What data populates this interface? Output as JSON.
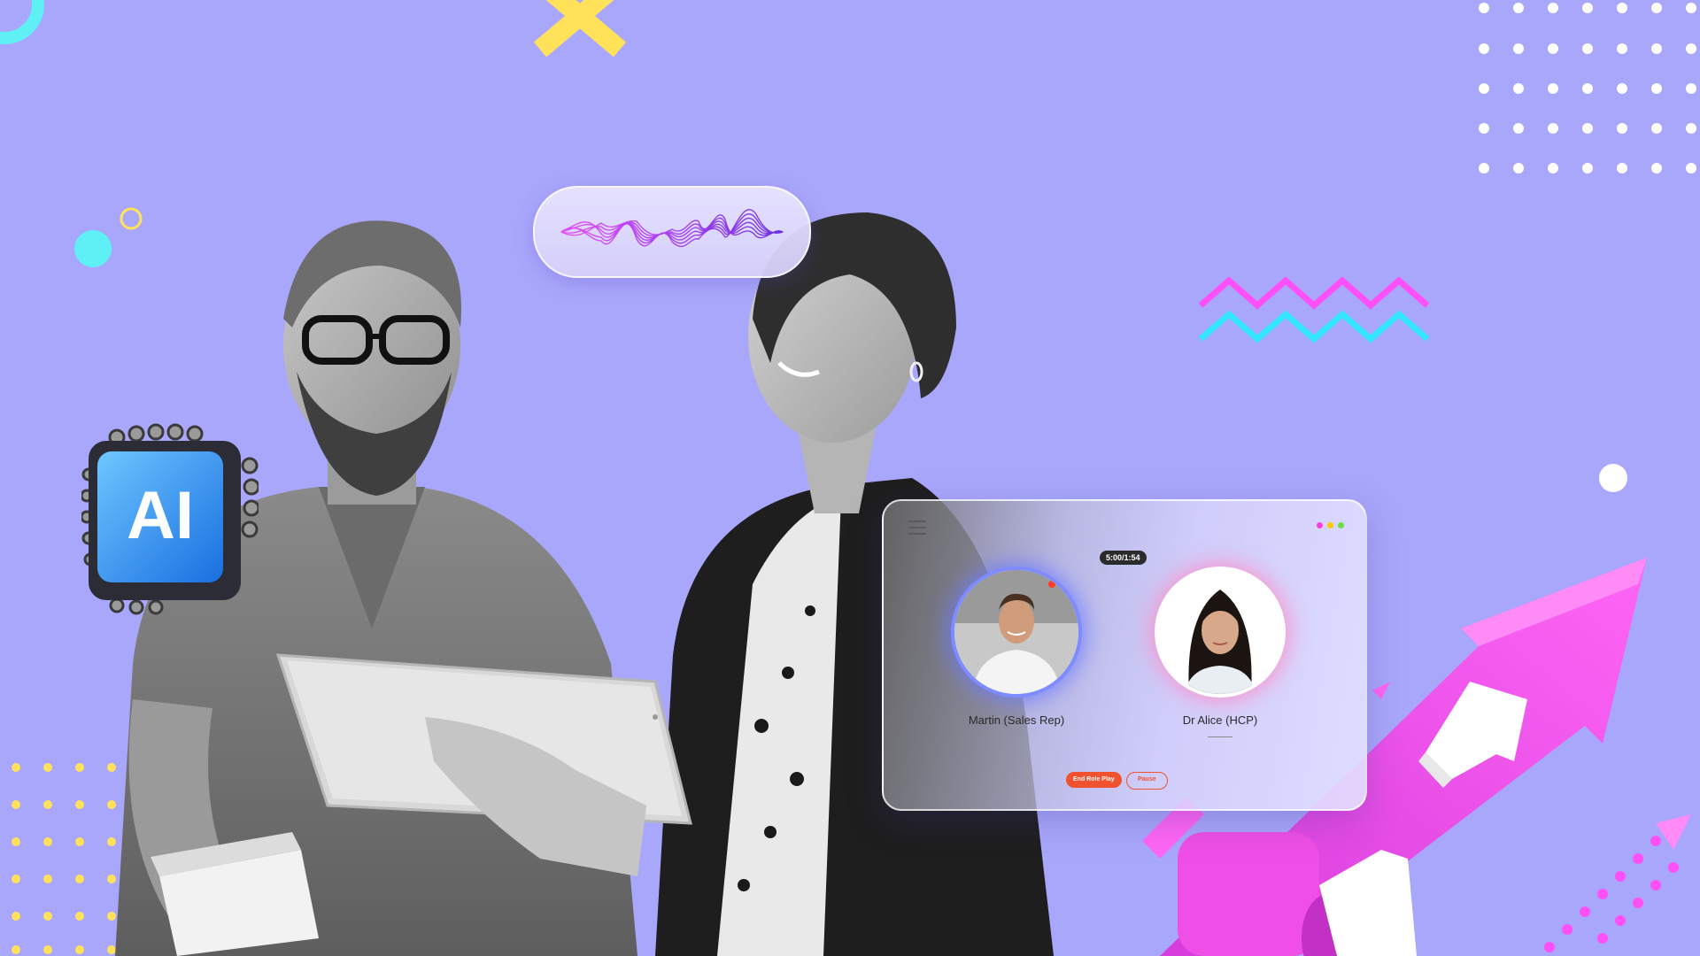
{
  "decor": {
    "colors": {
      "background": "#a9a7fb",
      "cyan": "#5ef0f5",
      "yellow": "#ffe15a",
      "magenta": "#ff4ff6",
      "white": "#ffffff",
      "orange": "#f0512e"
    },
    "icons": [
      "ring",
      "x-shape",
      "dot-grid",
      "zigzag",
      "upward-arrows",
      "ai-chip"
    ]
  },
  "chip": {
    "label": "AI"
  },
  "roleplay": {
    "timer": "5:00/1:54",
    "participants": [
      {
        "name": "Martin (Sales Rep)"
      },
      {
        "name": "Dr Alice (HCP)"
      }
    ],
    "buttons": {
      "end": "End Role Play",
      "pause": "Pause"
    },
    "window_dot_colors": [
      "#ff3ee0",
      "#ffc800",
      "#6adf46"
    ]
  }
}
